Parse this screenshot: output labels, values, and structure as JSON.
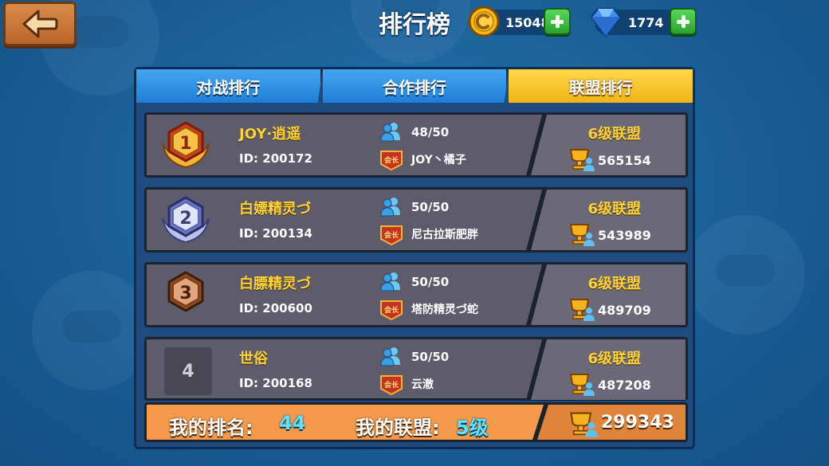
{
  "header": {
    "title": "排行榜",
    "coins": "15048",
    "gems": "1774"
  },
  "tabs": [
    {
      "label": "对战排行",
      "active": false
    },
    {
      "label": "合作排行",
      "active": false
    },
    {
      "label": "联盟排行",
      "active": true
    }
  ],
  "rankings": [
    {
      "rank": "1",
      "name": "JOY·逍遥",
      "id": "ID: 200172",
      "members": "48/50",
      "leader_badge": "会长",
      "leader": "JOY丶橘子",
      "level": "6级联盟",
      "score": "565154"
    },
    {
      "rank": "2",
      "name": "白嫖精灵づ",
      "id": "ID: 200134",
      "members": "50/50",
      "leader_badge": "会长",
      "leader": "尼古拉斯肥胖",
      "level": "6级联盟",
      "score": "543989"
    },
    {
      "rank": "3",
      "name": "白膘精灵づ",
      "id": "ID: 200600",
      "members": "50/50",
      "leader_badge": "会长",
      "leader": "塔防精灵づ蛇",
      "level": "6级联盟",
      "score": "489709"
    },
    {
      "rank": "4",
      "name": "世俗",
      "id": "ID: 200168",
      "members": "50/50",
      "leader_badge": "会长",
      "leader": "云澈",
      "level": "6级联盟",
      "score": "487208"
    }
  ],
  "footer": {
    "my_rank_label": "我的排名:",
    "my_rank_value": "44",
    "my_alliance_label": "我的联盟:",
    "my_alliance_value": "5级",
    "my_score": "299343"
  },
  "colors": {
    "gold": "#ffd23a",
    "silver": "#9aa6d6",
    "bronze": "#c07a4a",
    "tab_active": "#f0b414",
    "tab_inactive": "#1f7fd6"
  }
}
